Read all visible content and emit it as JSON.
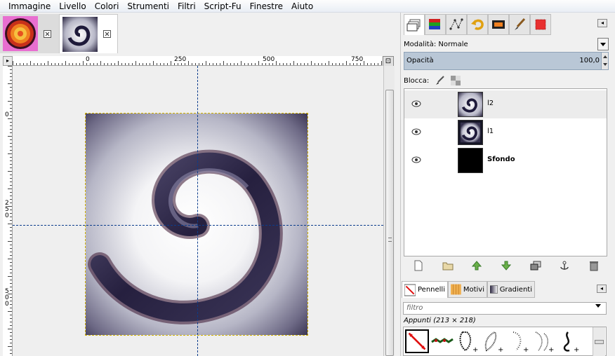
{
  "menubar": {
    "items": [
      "Immagine",
      "Livello",
      "Colori",
      "Strumenti",
      "Filtri",
      "Script-Fu",
      "Finestre",
      "Aiuto"
    ]
  },
  "rulers": {
    "horizontal_labels": [
      "0",
      "250",
      "500",
      "750"
    ],
    "vertical_labels": [
      "0",
      "250",
      "500"
    ]
  },
  "layers_panel": {
    "mode_label": "Modalità: Normale",
    "opacity_label": "Opacità",
    "opacity_value": "100,0",
    "lock_label": "Blocca:",
    "layers": [
      {
        "name": "l2",
        "selected": true,
        "visible": true
      },
      {
        "name": "l1",
        "selected": false,
        "visible": true
      },
      {
        "name": "Sfondo",
        "selected": false,
        "visible": true
      }
    ]
  },
  "brushes_panel": {
    "tabs": [
      "Pennelli",
      "Motivi",
      "Gradienti"
    ],
    "filter_placeholder": "filtro",
    "brush_info": "Appunti (213 × 218)"
  },
  "colors": {
    "guide": "#0a3c8c",
    "selection": "#d4b400",
    "opacity_bar": "#b9c7d6"
  },
  "icons": {
    "dock_tabs": [
      "layers-icon",
      "channels-icon",
      "paths-icon",
      "undo-history-icon",
      "image-preview-icon",
      "brush-tool-icon",
      "color-icon"
    ],
    "layer_buttons": [
      "new-layer-icon",
      "layer-group-icon",
      "raise-layer-icon",
      "lower-layer-icon",
      "duplicate-layer-icon",
      "anchor-layer-icon",
      "delete-layer-icon"
    ]
  }
}
